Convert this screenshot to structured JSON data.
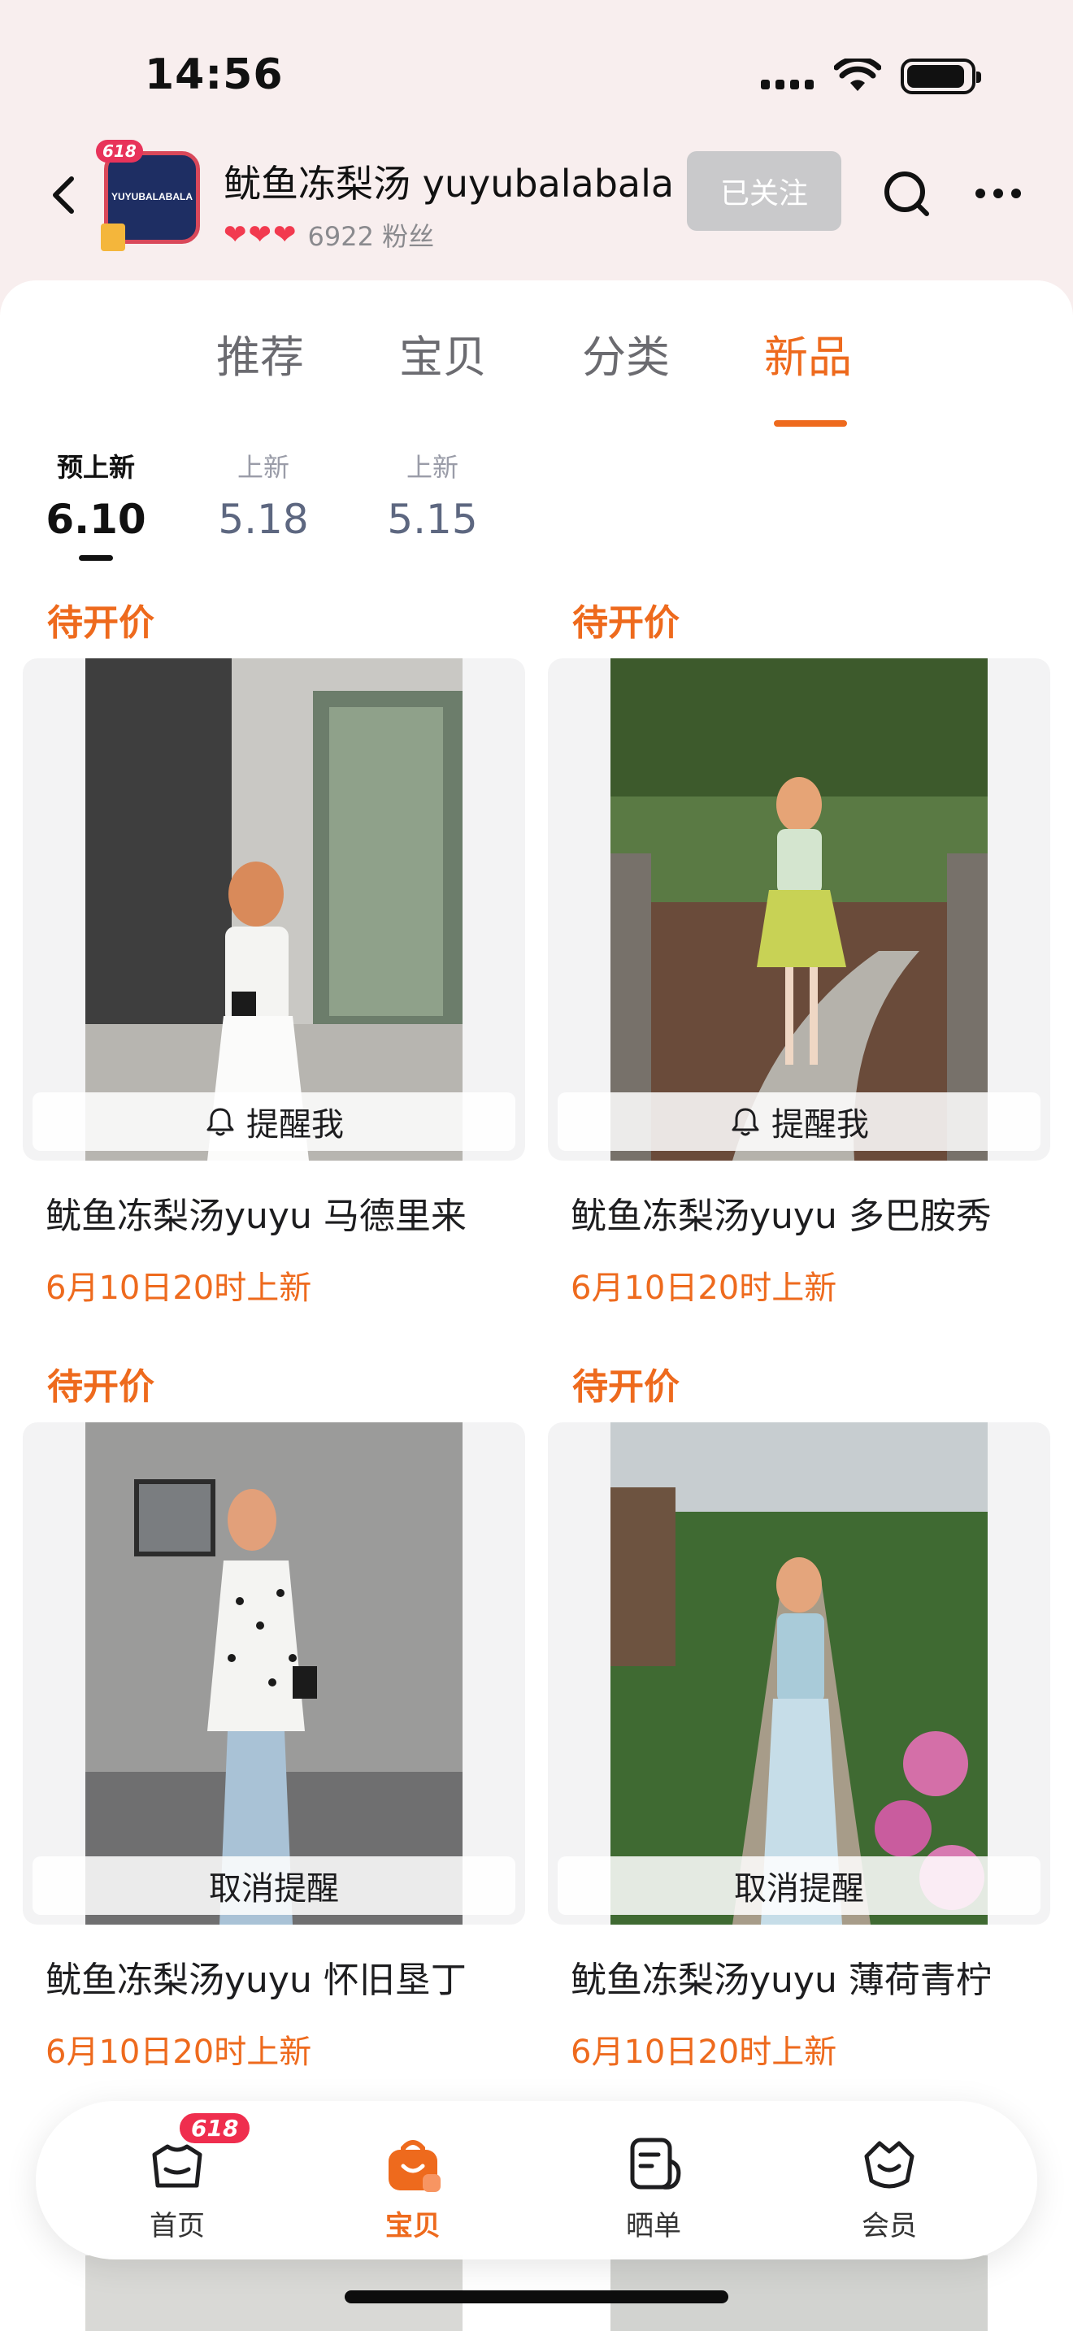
{
  "status_bar": {
    "time": "14:56"
  },
  "shop": {
    "name": "鱿鱼冻梨汤 yuyubalabala",
    "avatar_text": "YUYUBALABALA",
    "avatar_badge": "618",
    "fans": "6922 粉丝",
    "hearts": 3,
    "follow_label": "已关注"
  },
  "main_tabs": [
    {
      "label": "推荐",
      "active": false
    },
    {
      "label": "宝贝",
      "active": false
    },
    {
      "label": "分类",
      "active": false
    },
    {
      "label": "新品",
      "active": true
    }
  ],
  "date_tabs": [
    {
      "label": "预上新",
      "date": "6.10",
      "active": true
    },
    {
      "label": "上新",
      "date": "5.18",
      "active": false
    },
    {
      "label": "上新",
      "date": "5.15",
      "active": false
    }
  ],
  "products": [
    {
      "price": "待开价",
      "title": "鱿鱼冻梨汤yuyu 马德里来",
      "release": "6月10日20时上新",
      "action": "提醒我",
      "bell": true
    },
    {
      "price": "待开价",
      "title": "鱿鱼冻梨汤yuyu 多巴胺秀",
      "release": "6月10日20时上新",
      "action": "提醒我",
      "bell": true
    },
    {
      "price": "待开价",
      "title": "鱿鱼冻梨汤yuyu 怀旧垦丁",
      "release": "6月10日20时上新",
      "action": "取消提醒",
      "bell": false
    },
    {
      "price": "待开价",
      "title": "鱿鱼冻梨汤yuyu 薄荷青柠",
      "release": "6月10日20时上新",
      "action": "取消提醒",
      "bell": false
    }
  ],
  "bottom_nav": [
    {
      "label": "首页",
      "icon": "home-icon",
      "badge": "618",
      "active": false
    },
    {
      "label": "宝贝",
      "icon": "bag-icon",
      "active": true
    },
    {
      "label": "晒单",
      "icon": "review-icon",
      "active": false
    },
    {
      "label": "会员",
      "icon": "member-icon",
      "active": false
    }
  ],
  "colors": {
    "accent": "#ee6a1d",
    "background": "#f8eeee",
    "follow_button": "#c9c9cb"
  }
}
